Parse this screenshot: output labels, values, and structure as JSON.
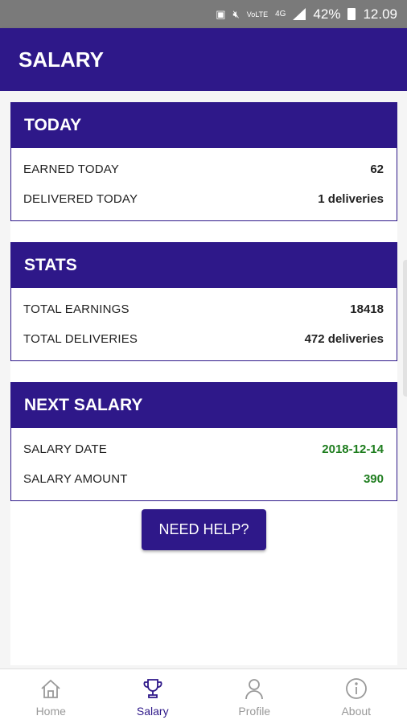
{
  "status_bar": {
    "battery": "42%",
    "time": "12.09",
    "network": "4G",
    "volte": "VoLTE"
  },
  "app_bar": {
    "title": "SALARY"
  },
  "today": {
    "title": "TODAY",
    "rows": [
      {
        "label": "EARNED TODAY",
        "value": "62"
      },
      {
        "label": "DELIVERED TODAY",
        "value": "1 deliveries"
      }
    ]
  },
  "stats": {
    "title": "STATS",
    "rows": [
      {
        "label": "TOTAL EARNINGS",
        "value": "18418"
      },
      {
        "label": "TOTAL DELIVERIES",
        "value": "472 deliveries"
      }
    ]
  },
  "next_salary": {
    "title": "NEXT SALARY",
    "rows": [
      {
        "label": "SALARY DATE",
        "value": "2018-12-14"
      },
      {
        "label": "SALARY AMOUNT",
        "value": "390"
      }
    ]
  },
  "help_button": {
    "label": "NEED HELP?"
  },
  "bottom_nav": {
    "items": [
      {
        "label": "Home",
        "icon": "home-icon"
      },
      {
        "label": "Salary",
        "icon": "trophy-icon",
        "active": true
      },
      {
        "label": "Profile",
        "icon": "person-icon"
      },
      {
        "label": "About",
        "icon": "info-icon"
      }
    ]
  },
  "colors": {
    "primary": "#2e1889",
    "value_green": "#1e7d1e",
    "nav_inactive": "#999999"
  }
}
